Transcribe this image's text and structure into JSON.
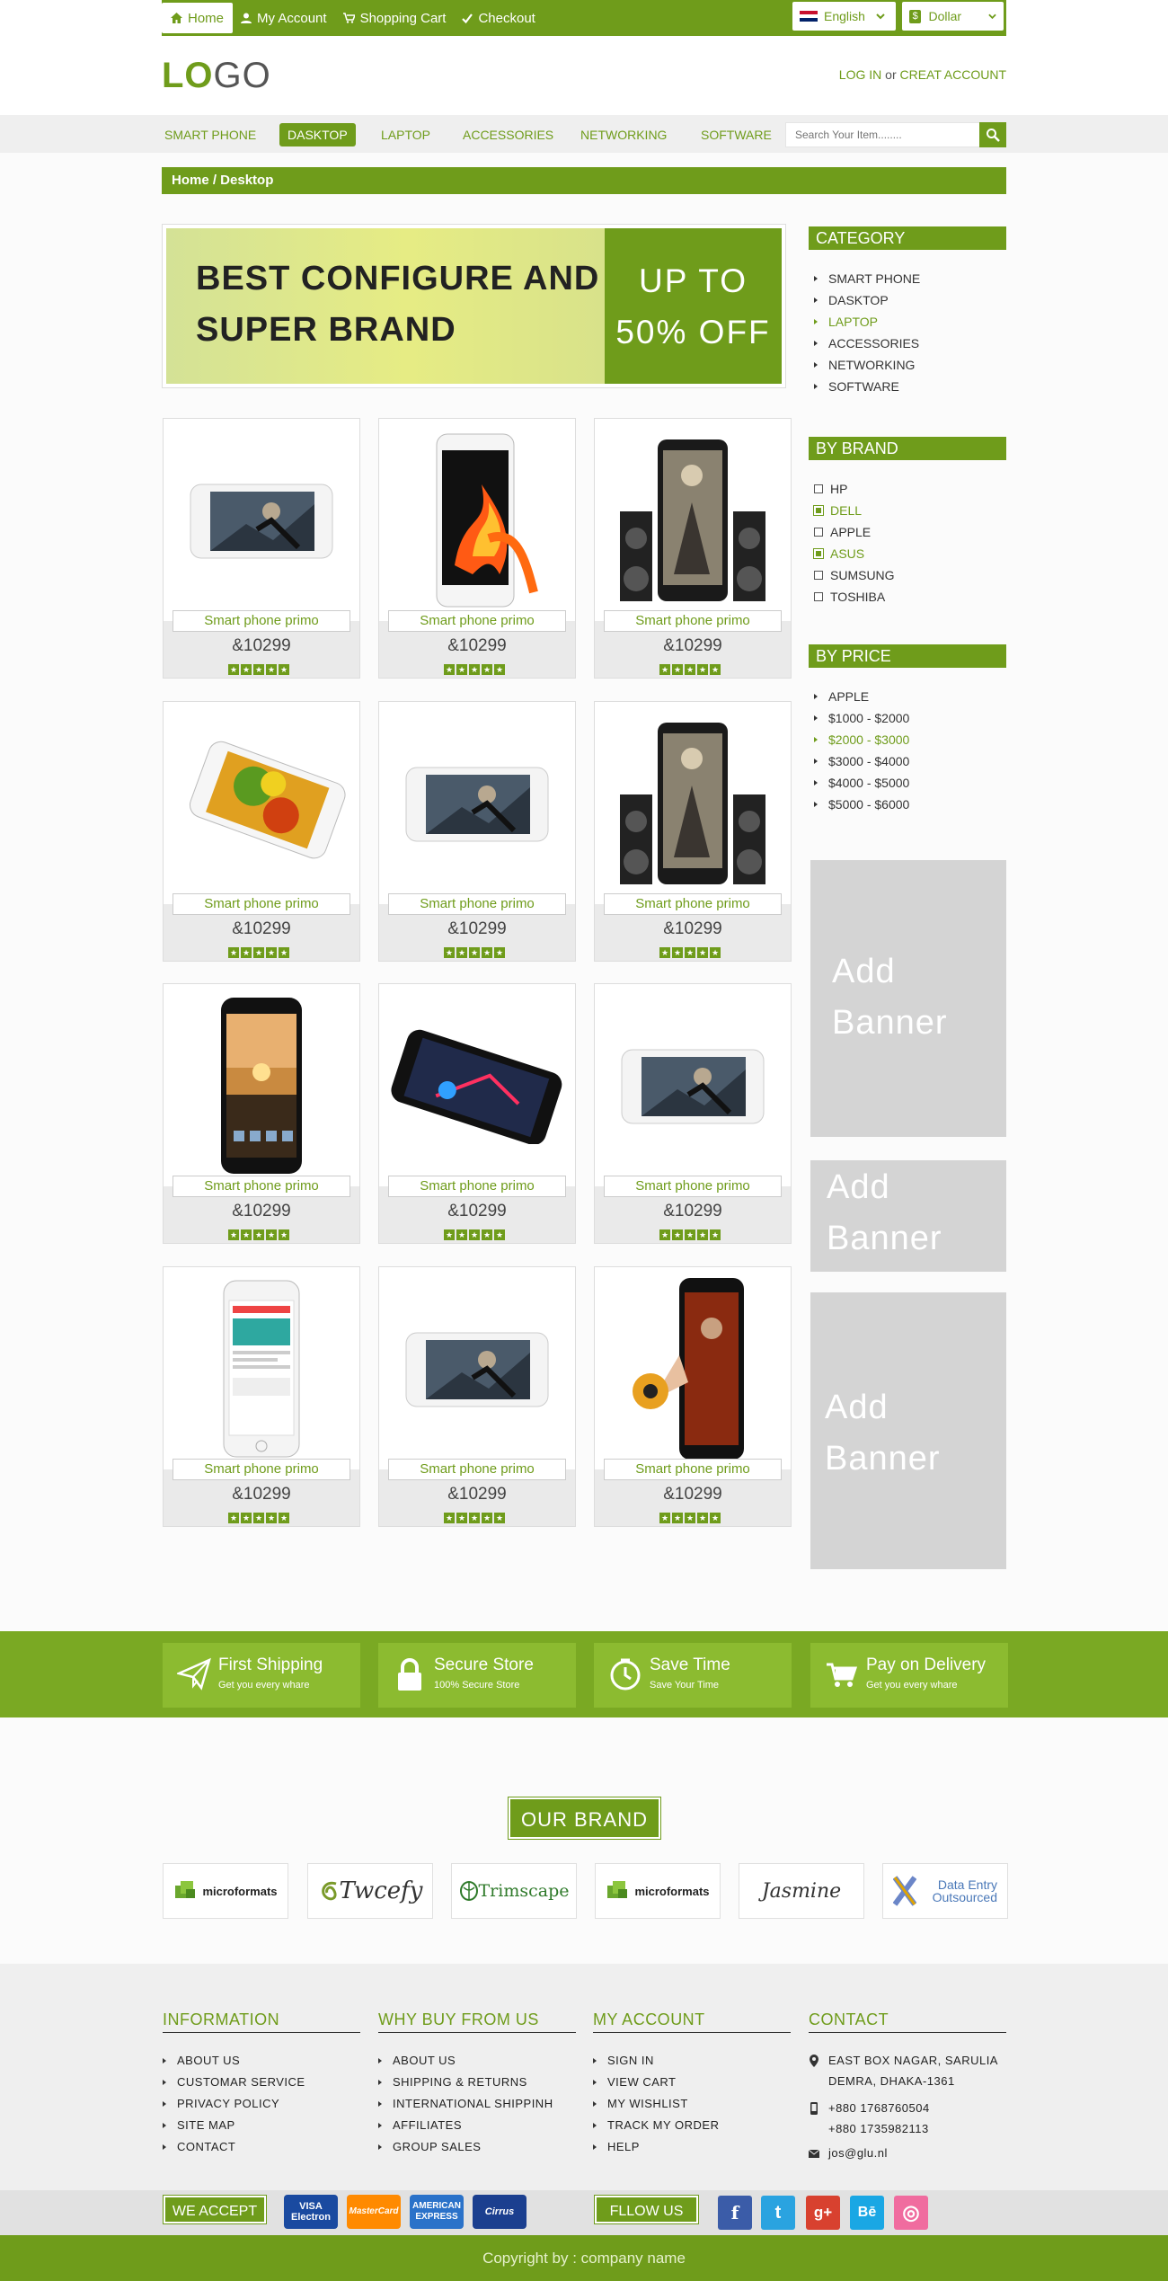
{
  "topnav": {
    "items": [
      {
        "label": "Home",
        "icon": "home-icon"
      },
      {
        "label": "My Account",
        "icon": "user-icon"
      },
      {
        "label": "Shopping Cart",
        "icon": "cart-icon"
      },
      {
        "label": "Checkout",
        "icon": "check-icon"
      }
    ],
    "language": "English",
    "currency": "Dollar"
  },
  "header": {
    "logo_a": "LO",
    "logo_b": "GO",
    "login": "LOG IN",
    "or": "or",
    "create": "CREAT ACCOUNT"
  },
  "mainnav": {
    "items": [
      "SMART PHONE",
      "DASKTOP",
      "LAPTOP",
      "ACCESSORIES",
      "NETWORKING",
      "SOFTWARE"
    ],
    "active": "DASKTOP",
    "search_placeholder": "Search Your Item........"
  },
  "breadcrumb": "Home / Desktop",
  "banner": {
    "line1": "BEST CONFIGURE AND",
    "line2": "SUPER BRAND",
    "offer1": "UP TO",
    "offer2": "50% OFF"
  },
  "products": [
    {
      "name": "Smart phone primo",
      "price": "&10299",
      "rating": 5
    },
    {
      "name": "Smart phone primo",
      "price": "&10299",
      "rating": 5
    },
    {
      "name": "Smart phone primo",
      "price": "&10299",
      "rating": 5
    },
    {
      "name": "Smart phone primo",
      "price": "&10299",
      "rating": 5
    },
    {
      "name": "Smart phone primo",
      "price": "&10299",
      "rating": 5
    },
    {
      "name": "Smart phone primo",
      "price": "&10299",
      "rating": 5
    },
    {
      "name": "Smart phone primo",
      "price": "&10299",
      "rating": 5
    },
    {
      "name": "Smart phone primo",
      "price": "&10299",
      "rating": 5
    },
    {
      "name": "Smart phone primo",
      "price": "&10299",
      "rating": 5
    },
    {
      "name": "Smart phone primo",
      "price": "&10299",
      "rating": 5
    },
    {
      "name": "Smart phone primo",
      "price": "&10299",
      "rating": 5
    },
    {
      "name": "Smart phone primo",
      "price": "&10299",
      "rating": 5
    }
  ],
  "sidebar": {
    "category": {
      "title": "CATEGORY",
      "items": [
        {
          "label": "SMART PHONE",
          "active": false
        },
        {
          "label": "DASKTOP",
          "active": false
        },
        {
          "label": "LAPTOP",
          "active": true
        },
        {
          "label": "ACCESSORIES",
          "active": false
        },
        {
          "label": "NETWORKING",
          "active": false
        },
        {
          "label": "SOFTWARE",
          "active": false
        }
      ]
    },
    "brand": {
      "title": "BY BRAND",
      "items": [
        {
          "label": "HP",
          "checked": false
        },
        {
          "label": "DELL",
          "checked": true
        },
        {
          "label": "APPLE",
          "checked": false
        },
        {
          "label": "ASUS",
          "checked": true
        },
        {
          "label": "SUMSUNG",
          "checked": false
        },
        {
          "label": "TOSHIBA",
          "checked": false
        }
      ]
    },
    "price": {
      "title": "BY PRICE",
      "items": [
        {
          "label": "APPLE",
          "active": false
        },
        {
          "label": "$1000 - $2000",
          "active": false
        },
        {
          "label": "$2000 - $3000",
          "active": true
        },
        {
          "label": "$3000 - $4000",
          "active": false
        },
        {
          "label": "$4000 - $5000",
          "active": false
        },
        {
          "label": "$5000 - $6000",
          "active": false
        }
      ]
    },
    "ads": [
      {
        "l1": "Add",
        "l2": "Banner"
      },
      {
        "l1": "Add",
        "l2": "Banner"
      },
      {
        "l1": "Add",
        "l2": "Banner"
      }
    ]
  },
  "features": [
    {
      "title": "First Shipping",
      "sub": "Get you every whare",
      "icon": "paper-plane-icon"
    },
    {
      "title": "Secure Store",
      "sub": "100% Secure Store",
      "icon": "lock-icon"
    },
    {
      "title": "Save Time",
      "sub": "Save Your Time",
      "icon": "clock-icon"
    },
    {
      "title": "Pay on Delivery",
      "sub": "Get you every whare",
      "icon": "cart-icon"
    }
  ],
  "brands": {
    "title": "OUR BRAND",
    "logos": [
      "microformats",
      "Twcefy",
      "Trimscape",
      "microformats",
      "Jasmine",
      "Data Entry Outsourced"
    ]
  },
  "footer": {
    "columns": [
      {
        "title": "INFORMATION",
        "items": [
          "ABOUT US",
          "CUSTOMAR SERVICE",
          "PRIVACY POLICY",
          "SITE MAP",
          "CONTACT"
        ]
      },
      {
        "title": "WHY BUY FROM US",
        "items": [
          "ABOUT US",
          "SHIPPING & RETURNS",
          "INTERNATIONAL SHIPPINH",
          "AFFILIATES",
          "GROUP SALES"
        ]
      },
      {
        "title": "MY ACCOUNT",
        "items": [
          "SIGN IN",
          "VIEW CART",
          "MY WISHLIST",
          "TRACK MY ORDER",
          "HELP"
        ]
      }
    ],
    "contact": {
      "title": "CONTACT",
      "address1": "EAST BOX NAGAR, SARULIA",
      "address2": "DEMRA, DHAKA-1361",
      "phone1": "+880 1768760504",
      "phone2": "+880 1735982113",
      "email": "jos@glu.nl"
    },
    "we_accept": "WE ACCEPT",
    "cards": [
      "VISA Electron",
      "MasterCard",
      "AMERICAN EXPRESS",
      "Cirrus"
    ],
    "follow": "FLLOW US",
    "social": [
      "f",
      "t",
      "g+",
      "Bē",
      "◎"
    ],
    "copyright": "Copyright by : company name"
  },
  "colors": {
    "accent": "#6f9c1b",
    "feature_bar": "#7aa923",
    "ad": "#d4d4d4"
  }
}
